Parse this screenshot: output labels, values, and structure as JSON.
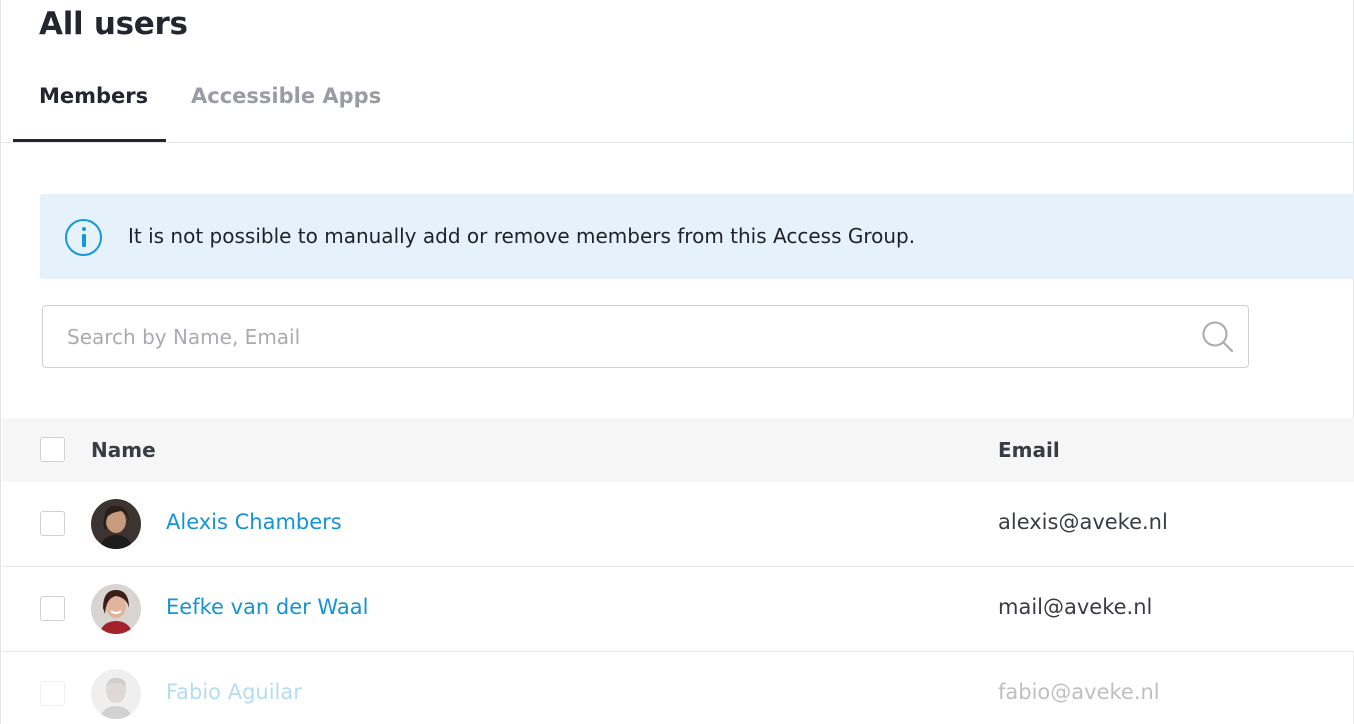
{
  "page": {
    "title": "All users"
  },
  "tabs": [
    {
      "label": "Members",
      "active": true
    },
    {
      "label": "Accessible Apps",
      "active": false
    }
  ],
  "banner": {
    "icon": "info-icon",
    "text": "It is not possible to manually add or remove members from this Access Group."
  },
  "search": {
    "placeholder": "Search by Name, Email",
    "value": "",
    "icon": "search-icon"
  },
  "table": {
    "columns": {
      "name": "Name",
      "email": "Email"
    },
    "rows": [
      {
        "name": "Alexis Chambers",
        "email": "alexis@aveke.nl",
        "avatar": "avatar-alexis"
      },
      {
        "name": "Eefke van der Waal",
        "email": "mail@aveke.nl",
        "avatar": "avatar-eefke"
      },
      {
        "name": "Fabio Aguilar",
        "email": "fabio@aveke.nl",
        "avatar": "avatar-fabio"
      }
    ]
  },
  "colors": {
    "accent": "#1593d6",
    "banner_bg": "#e6f2fb",
    "text_dark": "#23252f",
    "tab_inactive": "#9a9ca3"
  }
}
